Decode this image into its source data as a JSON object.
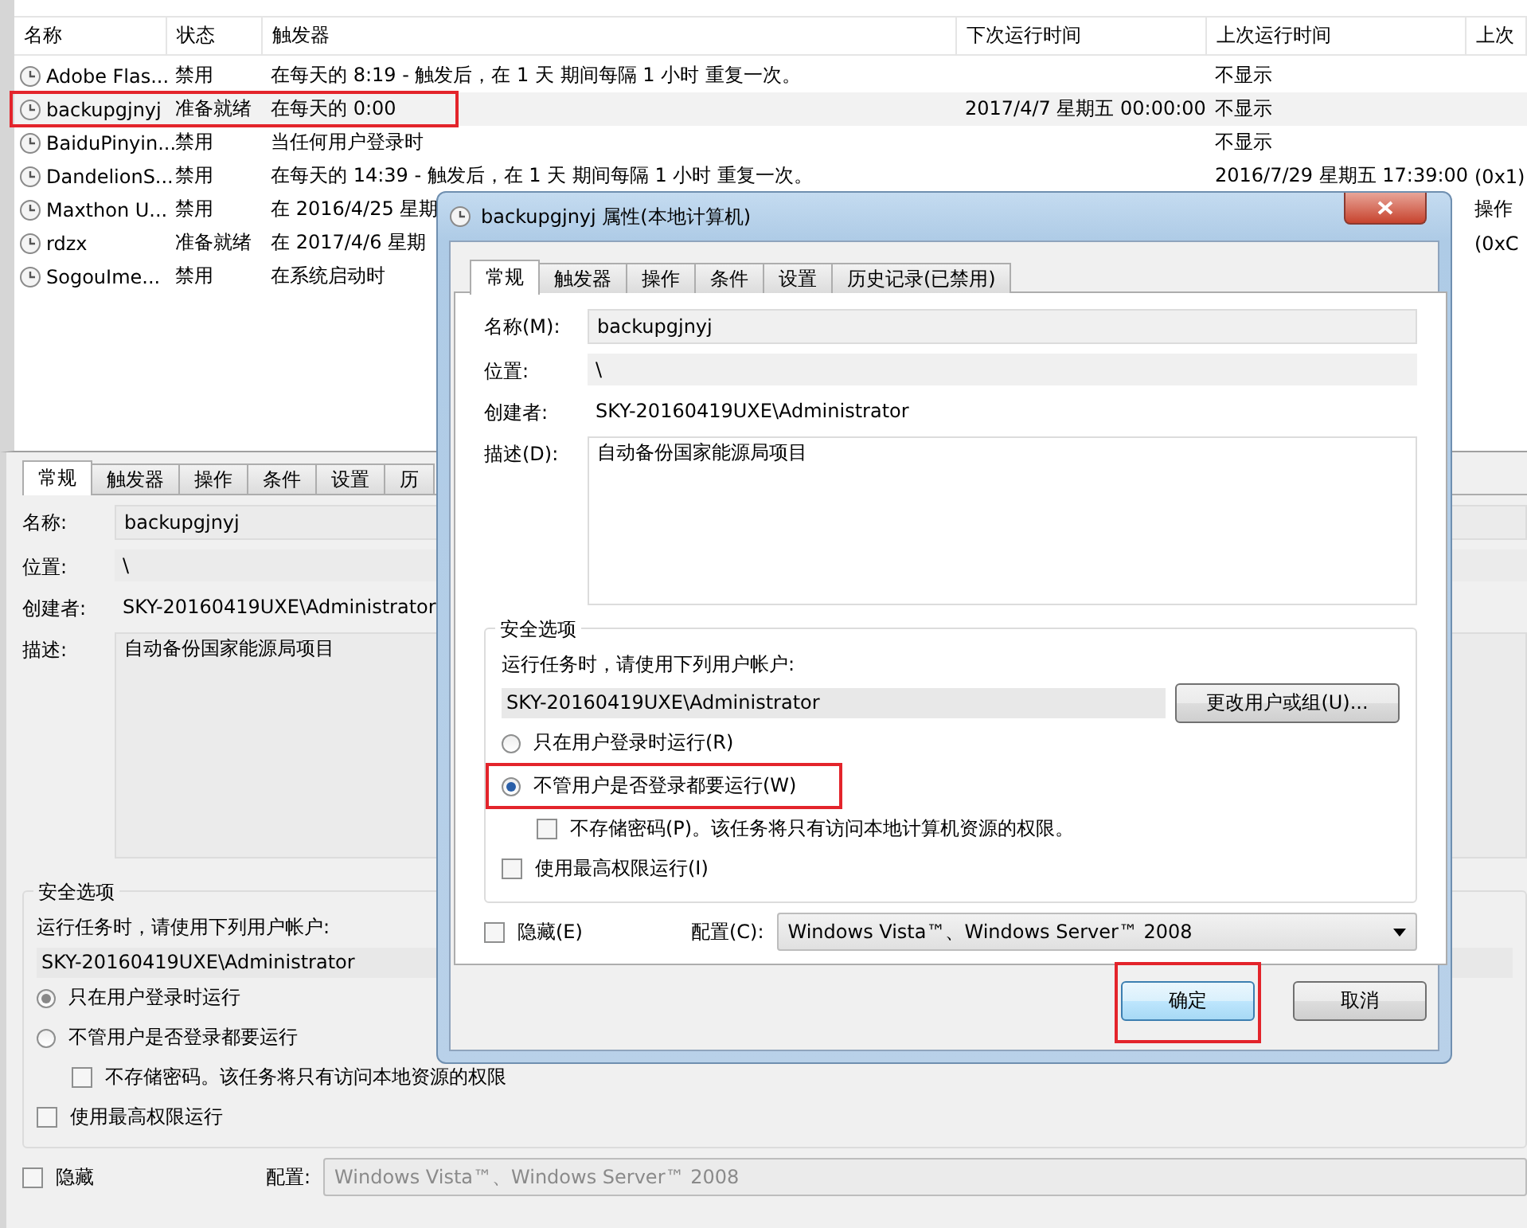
{
  "task_list": {
    "columns": [
      "名称",
      "状态",
      "触发器",
      "下次运行时间",
      "上次运行时间",
      "上次"
    ],
    "rows": [
      {
        "name": "Adobe Flas...",
        "status": "禁用",
        "trigger": "在每天的 8:19 - 触发后，在 1 天 期间每隔 1 小时 重复一次。",
        "last_run": "不显示",
        "selected": false,
        "highlighted": false
      },
      {
        "name": "backupgjnyj",
        "status": "准备就绪",
        "trigger": "在每天的 0:00",
        "next_run": "2017/4/7 星期五 00:00:00",
        "last_run": "不显示",
        "selected": true,
        "highlighted": true
      },
      {
        "name": "BaiduPinyin...",
        "status": "禁用",
        "trigger": "当任何用户登录时",
        "last_run": "不显示",
        "selected": false,
        "highlighted": false
      },
      {
        "name": "DandelionS...",
        "status": "禁用",
        "trigger": "在每天的 14:39 - 触发后，在 1 天 期间每隔 1 小时 重复一次。",
        "last_run": "2016/7/29 星期五 17:39:00",
        "last_result": "(0x1)",
        "selected": false,
        "highlighted": false
      },
      {
        "name": "Maxthon U...",
        "status": "禁用",
        "trigger": "在 2016/4/25 星期",
        "last_result": "操作",
        "selected": false,
        "highlighted": false
      },
      {
        "name": "rdzx",
        "status": "准备就绪",
        "trigger": "在 2017/4/6 星期",
        "last_result": "(0xC",
        "selected": false,
        "highlighted": false
      },
      {
        "name": "SogouIme...",
        "status": "禁用",
        "trigger": "在系统启动时",
        "selected": false,
        "highlighted": false
      }
    ]
  },
  "details": {
    "tabs": [
      {
        "label": "常规",
        "selected": true
      },
      {
        "label": "触发器",
        "selected": false
      },
      {
        "label": "操作",
        "selected": false
      },
      {
        "label": "条件",
        "selected": false
      },
      {
        "label": "设置",
        "selected": false
      },
      {
        "label": "历",
        "selected": false
      }
    ],
    "fields": [
      {
        "kind": "box",
        "label": "名称:",
        "value": "backupgjnyj"
      },
      {
        "kind": "bar",
        "label": "位置:",
        "value": "\\"
      },
      {
        "kind": "static",
        "label": "创建者:",
        "value": "SKY-20160419UXE\\Administrator"
      },
      {
        "kind": "area",
        "label": "描述:",
        "value": "自动备份国家能源局项目"
      }
    ],
    "security": {
      "title": "安全选项",
      "prompt": "运行任务时，请使用下列用户帐户:",
      "account": "SKY-20160419UXE\\Administrator",
      "options": [
        {
          "kind": "radio",
          "label": "只在用户登录时运行",
          "selected": true
        },
        {
          "kind": "radio",
          "label": "不管用户是否登录都要运行",
          "selected": false,
          "children": [
            {
              "kind": "checkbox",
              "label": "不存储密码。该任务将只有访问本地资源的权限",
              "checked": false
            }
          ]
        },
        {
          "kind": "checkbox",
          "label": "使用最高权限运行",
          "checked": false
        }
      ]
    },
    "hidden": {
      "label": "隐藏",
      "checked": false
    },
    "config": {
      "label": "配置:",
      "value": "Windows Vista™、Windows Server™ 2008"
    }
  },
  "dialog": {
    "title": "backupgjnyj 属性(本地计算机)",
    "tabs": [
      {
        "label": "常规",
        "selected": true
      },
      {
        "label": "触发器",
        "selected": false
      },
      {
        "label": "操作",
        "selected": false
      },
      {
        "label": "条件",
        "selected": false
      },
      {
        "label": "设置",
        "selected": false
      },
      {
        "label": "历史记录(已禁用)",
        "selected": false
      }
    ],
    "fields": [
      {
        "kind": "box",
        "label": "名称(M):",
        "value": "backupgjnyj"
      },
      {
        "kind": "bar",
        "label": "位置:",
        "value": "\\"
      },
      {
        "kind": "static",
        "label": "创建者:",
        "value": "SKY-20160419UXE\\Administrator"
      },
      {
        "kind": "area",
        "label": "描述(D):",
        "value": "自动备份国家能源局项目"
      }
    ],
    "security": {
      "title": "安全选项",
      "prompt": "运行任务时，请使用下列用户帐户:",
      "account": "SKY-20160419UXE\\Administrator",
      "change_button": "更改用户或组(U)...",
      "options": [
        {
          "kind": "radio",
          "label": "只在用户登录时运行(R)",
          "selected": false,
          "highlighted": false
        },
        {
          "kind": "radio",
          "label": "不管用户是否登录都要运行(W)",
          "selected": true,
          "highlighted": true,
          "children": [
            {
              "kind": "checkbox",
              "label": "不存储密码(P)。该任务将只有访问本地计算机资源的权限。",
              "checked": false
            }
          ]
        },
        {
          "kind": "checkbox",
          "label": "使用最高权限运行(I)",
          "checked": false
        }
      ]
    },
    "hidden": {
      "label": "隐藏(E)",
      "checked": false
    },
    "config": {
      "label": "配置(C):",
      "value": "Windows Vista™、Windows Server™ 2008"
    },
    "buttons": [
      {
        "label": "确定",
        "highlighted": true
      },
      {
        "label": "取消",
        "highlighted": false
      }
    ]
  }
}
